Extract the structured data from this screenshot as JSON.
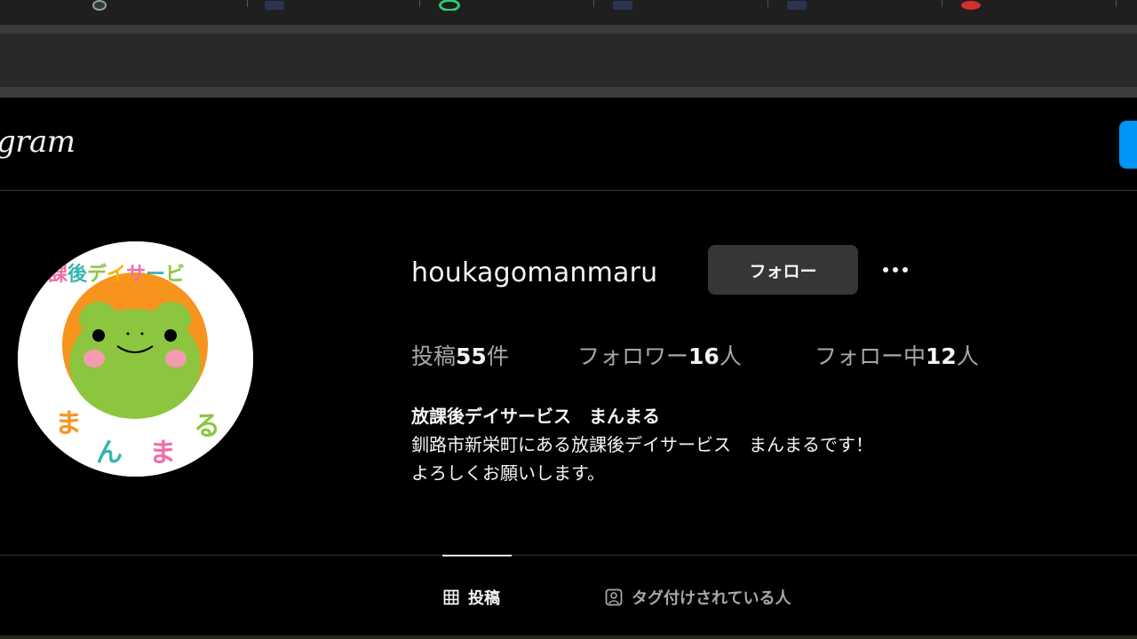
{
  "browser": {
    "tabs": [
      {
        "favicon": "app-icon",
        "title": ""
      },
      {
        "favicon": "doc-icon",
        "title": ""
      },
      {
        "favicon": "green-circle-icon",
        "title": ""
      },
      {
        "favicon": "doc-icon",
        "title": ""
      },
      {
        "favicon": "doc-icon",
        "title": ""
      },
      {
        "favicon": "red-app-icon",
        "title": ""
      }
    ]
  },
  "header": {
    "logo_text": "gram",
    "action_color": "#0095f6"
  },
  "profile": {
    "avatar": {
      "top_text": "課後デイサービ",
      "bottom_text": [
        "ま",
        "ん",
        "ま",
        "る"
      ]
    },
    "username": "houkagomanmaru",
    "follow_label": "フォロー",
    "more_icon": "ellipsis-icon",
    "stats": {
      "posts_label": "投稿",
      "posts_count": "55",
      "posts_unit": "件",
      "followers_label": "フォロワー",
      "followers_count": "16",
      "followers_unit": "人",
      "following_label": "フォロー中",
      "following_count": "12",
      "following_unit": "人"
    },
    "bio": {
      "name": "放課後デイサービス　まんまる",
      "line1": "釧路市新栄町にある放課後デイサービス　まんまるです！",
      "line2": "よろしくお願いします。"
    }
  },
  "tabs": [
    {
      "icon": "grid-icon",
      "label": "投稿",
      "active": true
    },
    {
      "icon": "tagged-person-icon",
      "label": "タグ付けされている人",
      "active": false
    }
  ],
  "colors": {
    "background": "#000000",
    "button_bg": "#363636",
    "secondary_text": "#a8a8a8"
  }
}
